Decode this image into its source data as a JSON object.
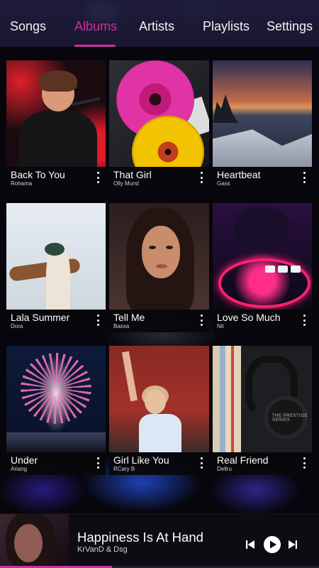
{
  "tabs": [
    {
      "label": "Songs",
      "active": false
    },
    {
      "label": "Albums",
      "active": true
    },
    {
      "label": "Artists",
      "active": false
    },
    {
      "label": "Playlists",
      "active": false
    },
    {
      "label": "Settings",
      "active": false
    }
  ],
  "accent_color": "#d52aa0",
  "albums": [
    {
      "title": "Back To You",
      "artist": "Rohama"
    },
    {
      "title": "That Girl",
      "artist": "Olly Murst"
    },
    {
      "title": "Heartbeat",
      "artist": "Gass"
    },
    {
      "title": "Lala Summer",
      "artist": "Dora"
    },
    {
      "title": "Tell Me",
      "artist": "Bassa"
    },
    {
      "title": "Love So Much",
      "artist": "Nit"
    },
    {
      "title": "Under",
      "artist": "Ariang"
    },
    {
      "title": "Girl Like You",
      "artist": "RCary B"
    },
    {
      "title": "Real Friend",
      "artist": "Dellru"
    }
  ],
  "album_art_text": {
    "headphones_brand": "THE PRESTIGE SERIES"
  },
  "now_playing": {
    "title": "Happiness Is At Hand",
    "artist": "KrVanD & Dsg",
    "progress_fraction": 0.35,
    "controls": {
      "prev_icon": "skip-previous-icon",
      "play_icon": "play-icon",
      "next_icon": "skip-next-icon"
    }
  }
}
